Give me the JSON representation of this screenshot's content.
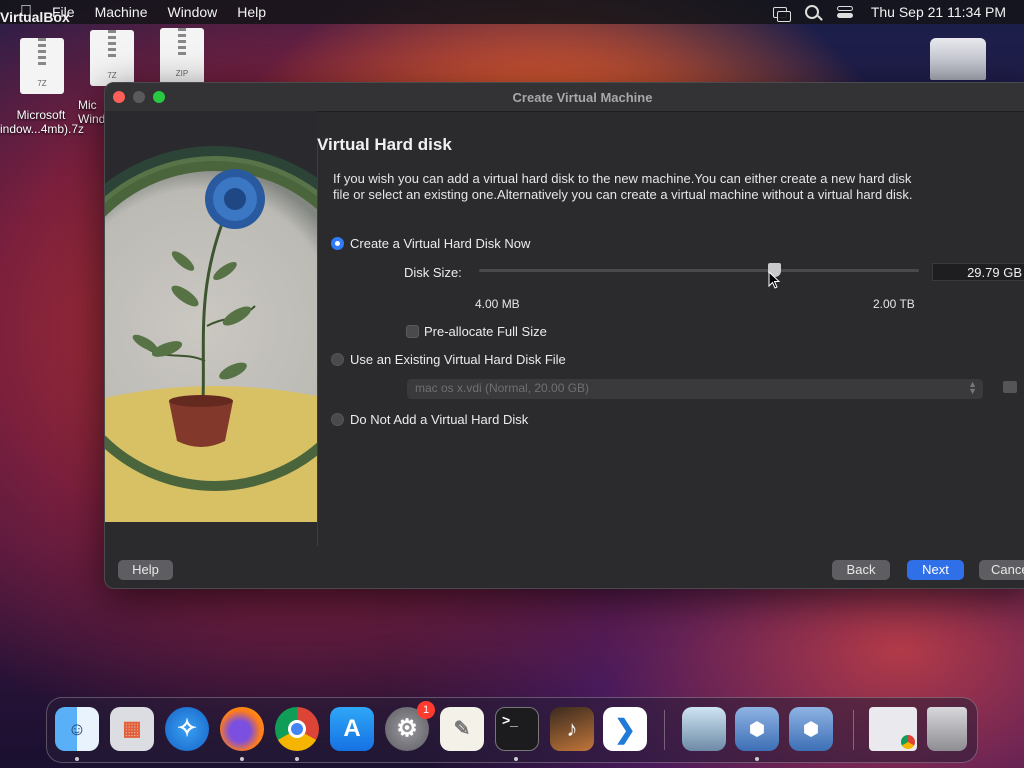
{
  "menubar": {
    "app_name": "VirtualBox",
    "items": [
      "File",
      "Machine",
      "Window",
      "Help"
    ],
    "clock": "Thu Sep 21  11:34 PM"
  },
  "desktop": {
    "files": [
      {
        "ext": "7Z",
        "label_lines": [
          "Microsoft",
          "indow...4mb).7z"
        ]
      },
      {
        "ext": "7Z",
        "label_lines": [
          "Mic",
          "Window"
        ]
      },
      {
        "ext": "ZIP",
        "label_lines": []
      }
    ]
  },
  "window": {
    "title": "Create Virtual Machine",
    "heading": "Virtual Hard disk",
    "description": "If you wish you can add a virtual hard disk to the new machine.You can either create a new hard disk file or select an existing one.Alternatively you can create a virtual machine without a virtual hard disk.",
    "options": {
      "create_now": {
        "label": "Create a Virtual Hard Disk Now",
        "selected": true
      },
      "use_existing": {
        "label": "Use an Existing Virtual Hard Disk File",
        "selected": false
      },
      "no_disk": {
        "label": "Do Not Add a Virtual Hard Disk",
        "selected": false
      }
    },
    "disk_size": {
      "label": "Disk Size:",
      "value": "29.79 GB",
      "min_label": "4.00 MB",
      "max_label": "2.00 TB",
      "slider_fraction": 0.67
    },
    "preallocate": {
      "label": "Pre-allocate Full Size",
      "checked": false
    },
    "existing_file": {
      "selected": "mac os x.vdi (Normal, 20.00 GB)"
    },
    "buttons": {
      "help": "Help",
      "back": "Back",
      "next": "Next",
      "cancel": "Cance"
    }
  },
  "dock": {
    "apps": [
      "finder-icon",
      "launchpad-icon",
      "safari-icon",
      "firefox-icon",
      "chrome-icon",
      "app-store-icon",
      "system-settings-icon",
      "textedit-icon",
      "terminal-icon",
      "garageband-icon",
      "vscode-icon",
      "preview-icon",
      "virtualbox-icon",
      "virtualbox-vm-icon",
      "chrome-window-icon",
      "trash-icon"
    ],
    "settings_badge": "1"
  },
  "colors": {
    "accent": "#2f6fe8",
    "radio_selected": "#2f7cf6"
  }
}
